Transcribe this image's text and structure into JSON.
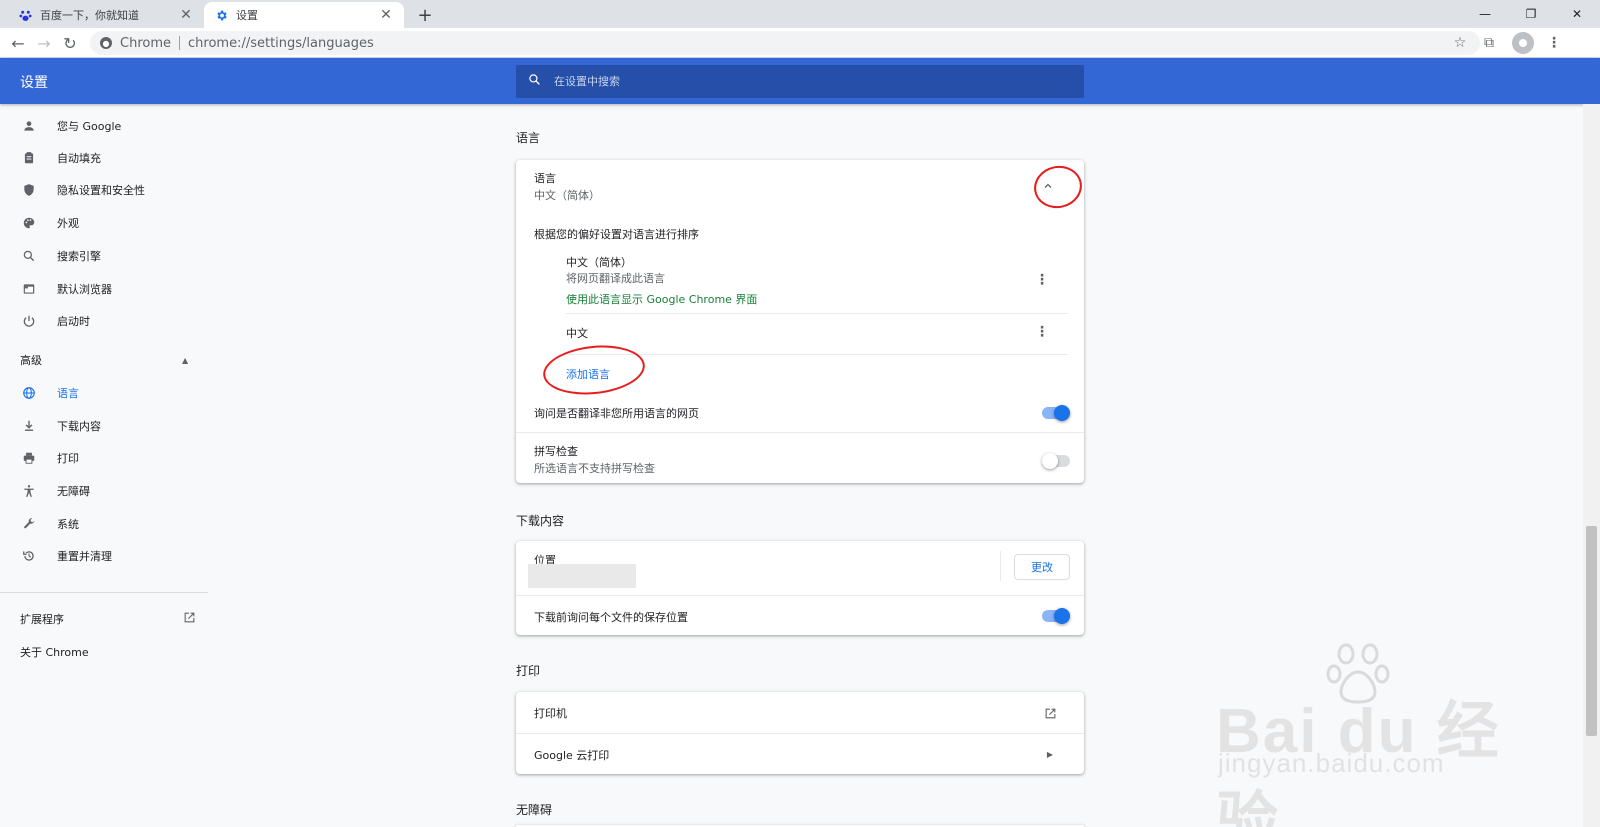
{
  "browser": {
    "tabs": [
      {
        "title": "百度一下，你就知道",
        "favicon": "baidu-paw-icon",
        "active": false
      },
      {
        "title": "设置",
        "favicon": "gear-icon",
        "active": true
      }
    ],
    "address": {
      "chip": "Chrome",
      "url": "chrome://settings/languages"
    }
  },
  "header": {
    "title": "设置",
    "search_placeholder": "在设置中搜索"
  },
  "sidebar": {
    "items": [
      {
        "label": "您与 Google",
        "icon": "person-icon"
      },
      {
        "label": "自动填充",
        "icon": "clipboard-icon"
      },
      {
        "label": "隐私设置和安全性",
        "icon": "shield-icon"
      },
      {
        "label": "外观",
        "icon": "palette-icon"
      },
      {
        "label": "搜索引擎",
        "icon": "search-icon"
      },
      {
        "label": "默认浏览器",
        "icon": "browser-icon"
      },
      {
        "label": "启动时",
        "icon": "power-icon"
      }
    ],
    "advanced_label": "高级",
    "advanced_items": [
      {
        "label": "语言",
        "icon": "globe-icon",
        "selected": true
      },
      {
        "label": "下载内容",
        "icon": "download-icon"
      },
      {
        "label": "打印",
        "icon": "printer-icon"
      },
      {
        "label": "无障碍",
        "icon": "accessibility-icon"
      },
      {
        "label": "系统",
        "icon": "wrench-icon"
      },
      {
        "label": "重置并清理",
        "icon": "restore-icon"
      }
    ],
    "extensions_label": "扩展程序",
    "about_label": "关于 Chrome"
  },
  "languages": {
    "section_title": "语言",
    "header_label": "语言",
    "header_value": "中文（简体）",
    "order_hint": "根据您的偏好设置对语言进行排序",
    "list": [
      {
        "name": "中文（简体）",
        "desc": "将网页翻译成此语言",
        "note": "使用此语言显示 Google Chrome 界面"
      },
      {
        "name": "中文"
      }
    ],
    "add_language": "添加语言",
    "offer_translate": "询问是否翻译非您所用语言的网页",
    "offer_translate_on": true,
    "spellcheck_label": "拼写检查",
    "spellcheck_sub": "所选语言不支持拼写检查",
    "spellcheck_on": false
  },
  "downloads": {
    "section_title": "下载内容",
    "location_label": "位置",
    "change_button": "更改",
    "ask_label": "下载前询问每个文件的保存位置",
    "ask_on": true
  },
  "printing": {
    "section_title": "打印",
    "printers_label": "打印机",
    "cloud_print_label": "Google 云打印"
  },
  "accessibility": {
    "section_title": "无障碍"
  },
  "watermark": {
    "brand": "Bai du 经验",
    "site": "jingyan.baidu.com"
  },
  "colors": {
    "header_blue": "#3367d6",
    "accent": "#1a73e8",
    "green_link": "#188038",
    "annotation_red": "#e81c1c"
  }
}
